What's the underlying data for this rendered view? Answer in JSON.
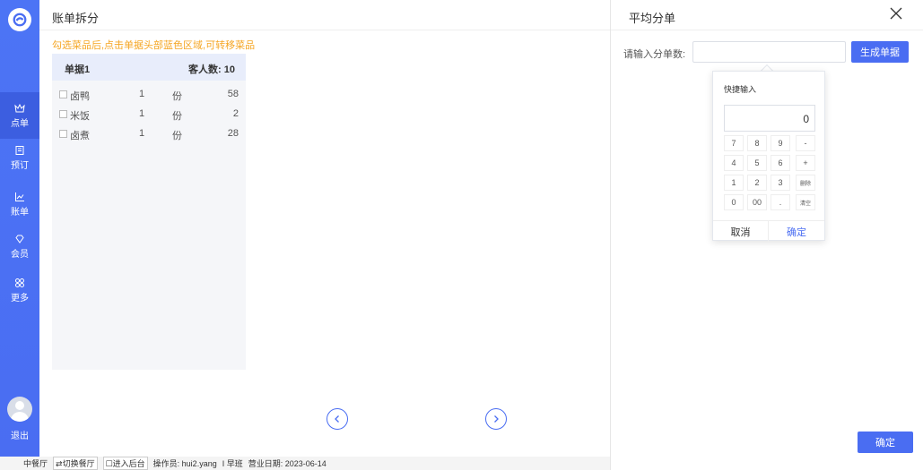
{
  "sidebar": {
    "items": [
      {
        "label": "点单",
        "icon": "crown-icon"
      },
      {
        "label": "预订",
        "icon": "book-icon"
      },
      {
        "label": "账单",
        "icon": "chart-icon"
      },
      {
        "label": "会员",
        "icon": "diamond-icon"
      },
      {
        "label": "更多",
        "icon": "grid-icon"
      }
    ],
    "logout_label": "退出"
  },
  "main": {
    "title": "账单拆分",
    "hint": "勾选菜品后,点击单据头部蓝色区域,可转移菜品",
    "bill": {
      "name": "单据1",
      "guests": "客人数: 10",
      "items": [
        {
          "name": "卤鸭",
          "qty": "1",
          "unit": "份",
          "price": "58"
        },
        {
          "name": "米饭",
          "qty": "1",
          "unit": "份",
          "price": "2"
        },
        {
          "name": "卤煮",
          "qty": "1",
          "unit": "份",
          "price": "28"
        }
      ]
    }
  },
  "statusbar": {
    "hall": "中餐厅",
    "switch_label": "切换餐厅",
    "backend_label": "进入后台",
    "operator": "操作员: hui2.yang",
    "shift": "I 早班",
    "business_date": "营业日期: 2023-06-14"
  },
  "panel": {
    "title": "平均分单",
    "split_label": "请输入分单数:",
    "split_value": "",
    "generate_label": "生成单据",
    "confirm_label": "确定"
  },
  "keypad": {
    "title": "快捷输入",
    "display": "0",
    "keys": [
      [
        "7",
        "8",
        "9",
        "-"
      ],
      [
        "4",
        "5",
        "6",
        "+"
      ],
      [
        "1",
        "2",
        "3",
        "删除"
      ],
      [
        "0",
        "00",
        ".",
        "清空"
      ]
    ],
    "cancel_label": "取消",
    "ok_label": "确定"
  },
  "colors": {
    "accent": "#4a6df2",
    "hint": "#f5a623",
    "sidebar": "#4a6df2"
  }
}
